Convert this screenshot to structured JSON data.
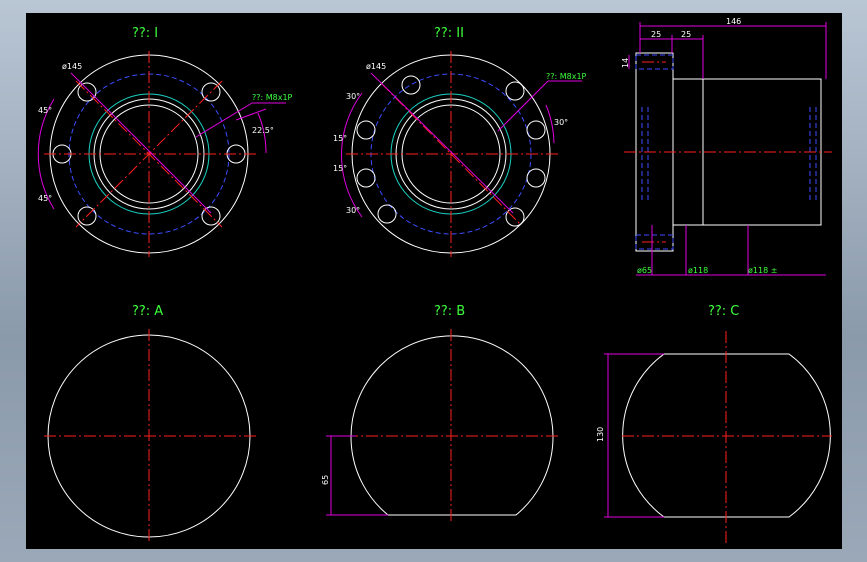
{
  "views": {
    "view1_title": "??: I",
    "view2_title": "??: II",
    "viewA_title": "??: A",
    "viewB_title": "??: B",
    "viewC_title": "??: C"
  },
  "dimensions": {
    "v1_dia": "ø145",
    "v1_thread": "??: M8x1P",
    "v1_ang_top": "45°",
    "v1_ang_bottom": "45°",
    "v1_ang_right": "22.5°",
    "v2_dia": "ø145",
    "v2_thread": "??: M8x1P",
    "v2_ang_a": "30°",
    "v2_ang_b": "15°",
    "v2_ang_c": "15°",
    "v2_ang_d": "30°",
    "v2_ang_right": "30°",
    "side_total": "146",
    "side_a": "25",
    "side_b": "25",
    "side_14": "14",
    "side_b1": "ø65",
    "side_b2": "ø118",
    "side_b3": "ø118 ±",
    "b_65": "65",
    "c_130": "130"
  },
  "colors": {
    "background": "#000000",
    "outline": "#ffffff",
    "centerline": "#ff2020",
    "dimension": "#e000e0",
    "hidden": "#3b4dff",
    "thread": "#19d4c4",
    "label": "#3cff3c"
  }
}
